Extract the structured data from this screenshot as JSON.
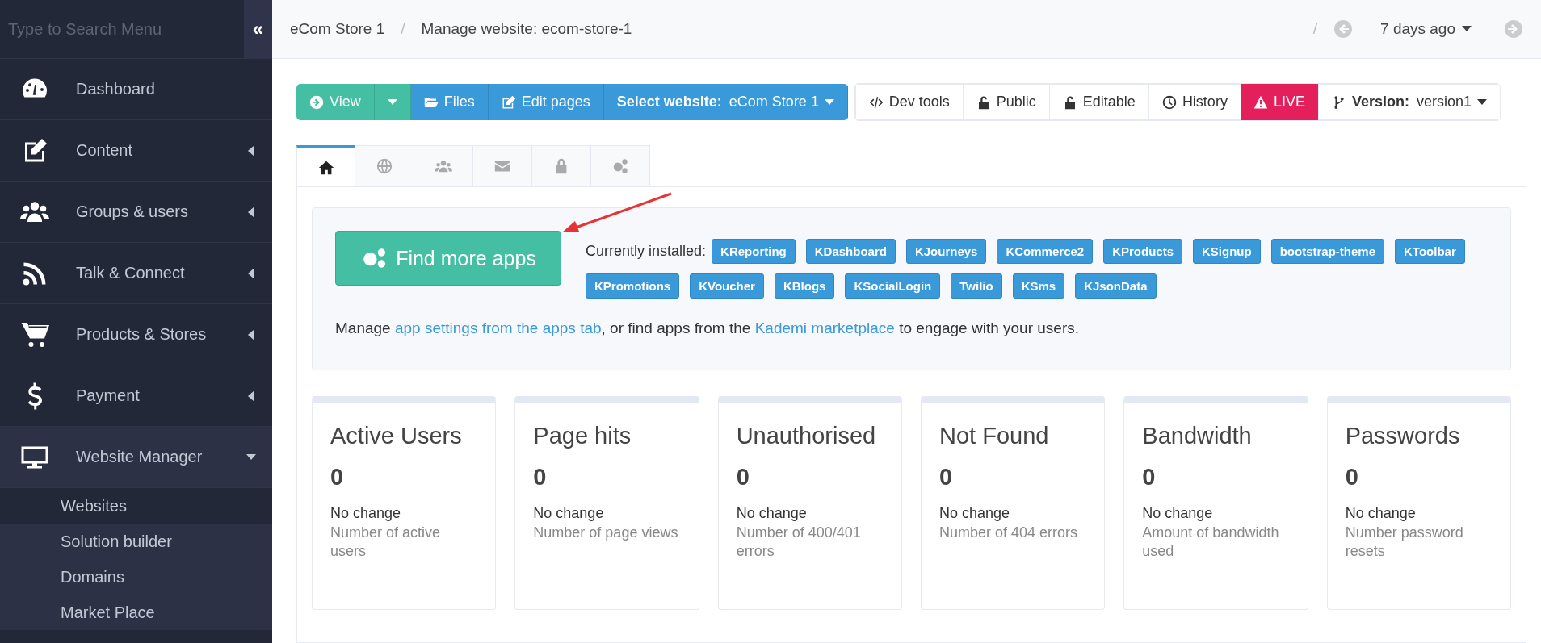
{
  "sidebar": {
    "search": {
      "placeholder": "Type to Search Menu"
    },
    "collapse": "«",
    "items": [
      {
        "label": "Dashboard",
        "selected": false,
        "has_children": false
      },
      {
        "label": "Content",
        "expanded": false,
        "selected": false,
        "has_children": true
      },
      {
        "label": "Groups & users",
        "expanded": false,
        "selected": false,
        "has_children": true
      },
      {
        "label": "Talk & Connect",
        "expanded": false,
        "selected": false,
        "has_children": true
      },
      {
        "label": "Products & Stores",
        "expanded": false,
        "selected": false,
        "has_children": true
      },
      {
        "label": "Payment",
        "expanded": false,
        "selected": false,
        "has_children": true
      },
      {
        "label": "Website Manager",
        "expanded": true,
        "selected": true,
        "has_children": true,
        "children": [
          {
            "label": "Websites",
            "selected": true
          },
          {
            "label": "Solution builder",
            "selected": false
          },
          {
            "label": "Domains",
            "selected": false
          },
          {
            "label": "Market Place",
            "selected": false
          }
        ]
      }
    ]
  },
  "breadcrumb": [
    "eCom Store 1",
    "Manage website: ecom-store-1"
  ],
  "breadcrumb_separator": "/",
  "history_nav": {
    "separator": "/",
    "label": "7 days ago"
  },
  "toolbar": {
    "view": "View",
    "files": "Files",
    "edit_pages": "Edit pages",
    "select_website": {
      "label": "Select website:",
      "value": "eCom Store 1"
    },
    "dev_tools": "Dev tools",
    "public": "Public",
    "editable": "Editable",
    "history": "History",
    "live": "LIVE",
    "version": {
      "label": "Version:",
      "value": "version1"
    }
  },
  "tabs": [
    {
      "selected": true
    },
    {
      "selected": false
    },
    {
      "selected": false
    },
    {
      "selected": false
    },
    {
      "selected": false
    },
    {
      "selected": false
    }
  ],
  "apps": {
    "button": "Find more apps",
    "installed_label": "Currently installed:",
    "installed": [
      "KReporting",
      "KDashboard",
      "KJourneys",
      "KCommerce2",
      "KProducts",
      "KSignup",
      "bootstrap-theme",
      "KToolbar",
      "KPromotions",
      "KVoucher",
      "KBlogs",
      "KSocialLogin",
      "Twilio",
      "KSms",
      "KJsonData"
    ],
    "note": {
      "before": "Manage ",
      "link1": "app settings from the apps tab",
      "middle": ", or find apps from the ",
      "link2": "Kademi marketplace",
      "after": " to engage with your users."
    }
  },
  "stats": [
    {
      "title": "Active Users",
      "value": "0",
      "change": "No change",
      "description": "Number of active users"
    },
    {
      "title": "Page hits",
      "value": "0",
      "change": "No change",
      "description": "Number of page views"
    },
    {
      "title": "Unauthorised",
      "value": "0",
      "change": "No change",
      "description": "Number of 400/401 errors"
    },
    {
      "title": "Not Found",
      "value": "0",
      "change": "No change",
      "description": "Number of 404 errors"
    },
    {
      "title": "Bandwidth",
      "value": "0",
      "change": "No change",
      "description": "Amount of bandwidth used"
    },
    {
      "title": "Passwords",
      "value": "0",
      "change": "No change",
      "description": "Number password resets"
    }
  ]
}
